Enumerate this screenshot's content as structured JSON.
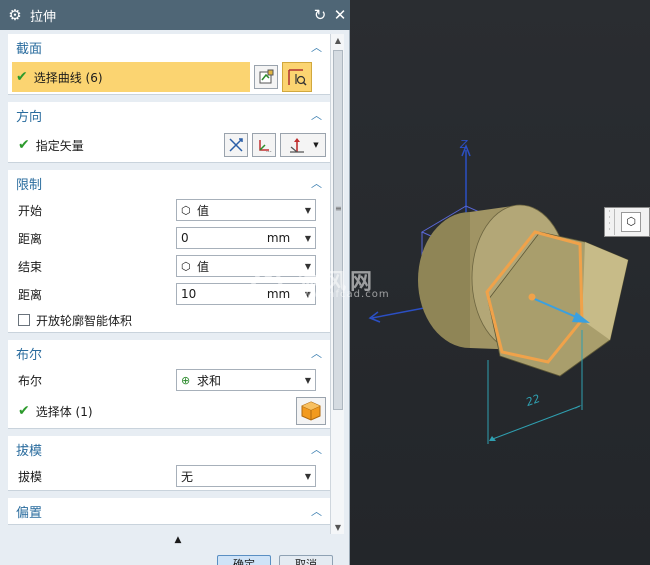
{
  "dialog": {
    "title": "拉伸",
    "gear_icon": "gear-icon",
    "reset_icon": "reset-icon",
    "close_icon": "close-icon"
  },
  "section": {
    "header": "截面",
    "select_curve_label": "选择曲线 (6)"
  },
  "direction": {
    "header": "方向",
    "vector_label": "指定矢量"
  },
  "limits": {
    "header": "限制",
    "start_label": "开始",
    "start_type": "值",
    "start_distance_label": "距离",
    "start_distance": "0",
    "start_unit": "mm",
    "end_label": "结束",
    "end_type": "值",
    "end_distance_label": "距离",
    "end_distance": "10",
    "end_unit": "mm",
    "open_profile_label": "开放轮廓智能体积"
  },
  "boolean": {
    "header": "布尔",
    "boolean_label": "布尔",
    "boolean_value": "求和",
    "select_body_label": "选择体 (1)"
  },
  "draft": {
    "header": "拔模",
    "draft_label": "拔模",
    "draft_value": "无"
  },
  "offset": {
    "header": "偏置"
  },
  "buttons": {
    "ok": "确定",
    "cancel": "取消"
  },
  "viewport": {
    "axis_z": "Z",
    "dimension_label": "22",
    "watermark_text": "沐风网",
    "watermark_url": "www.mfcad.com"
  },
  "colors": {
    "titlebar": "#4f6676",
    "selection_highlight": "#fbd471",
    "group_header": "#2a6c9e",
    "model_body": "#a89d6e",
    "profile": "#f0a24a",
    "direction_arrow": "#3aa0e0"
  }
}
